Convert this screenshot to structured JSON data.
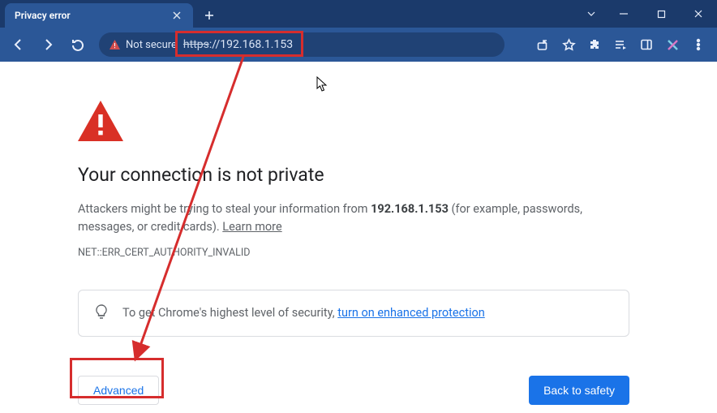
{
  "titlebar": {
    "tab_title": "Privacy error"
  },
  "toolbar": {
    "security_label": "Not secure",
    "url_scheme": "https",
    "url_rest": "://192.168.1.153"
  },
  "page": {
    "heading": "Your connection is not private",
    "body_prefix": "Attackers might be trying to steal your information from ",
    "body_host": "192.168.1.153",
    "body_suffix": " (for example, passwords, messages, or credit cards). ",
    "learn_more": "Learn more",
    "error_code": "NET::ERR_CERT_AUTHORITY_INVALID",
    "tip_text": "To get Chrome's highest level of security, ",
    "tip_link": "turn on enhanced protection",
    "advanced_label": "Advanced",
    "back_label": "Back to safety"
  },
  "colors": {
    "annotation": "#d62d2d",
    "primary": "#1a73e8",
    "titlebar_bg": "#1b3a6b",
    "toolbar_bg": "#2b5797"
  }
}
